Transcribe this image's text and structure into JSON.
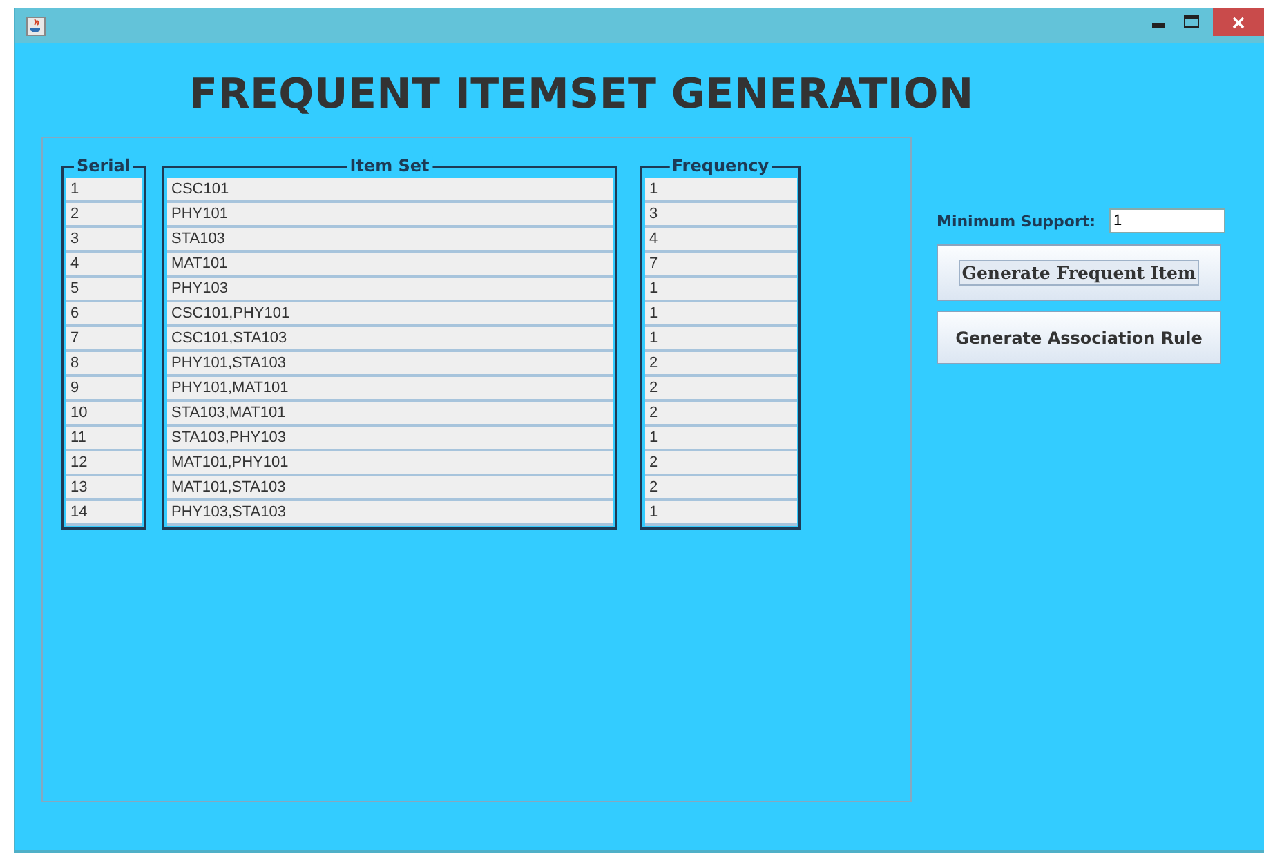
{
  "title": "FREQUENT ITEMSET GENERATION",
  "columns": [
    "Serial",
    "Item Set",
    "Frequency"
  ],
  "rows": [
    {
      "serial": "1",
      "itemset": "CSC101",
      "frequency": "1"
    },
    {
      "serial": "2",
      "itemset": "PHY101",
      "frequency": "3"
    },
    {
      "serial": "3",
      "itemset": "STA103",
      "frequency": "4"
    },
    {
      "serial": "4",
      "itemset": "MAT101",
      "frequency": "7"
    },
    {
      "serial": "5",
      "itemset": "PHY103",
      "frequency": "1"
    },
    {
      "serial": "6",
      "itemset": "CSC101,PHY101",
      "frequency": "1"
    },
    {
      "serial": "7",
      "itemset": "CSC101,STA103",
      "frequency": "1"
    },
    {
      "serial": "8",
      "itemset": "PHY101,STA103",
      "frequency": "2"
    },
    {
      "serial": "9",
      "itemset": "PHY101,MAT101",
      "frequency": "2"
    },
    {
      "serial": "10",
      "itemset": "STA103,MAT101",
      "frequency": "2"
    },
    {
      "serial": "11",
      "itemset": "STA103,PHY103",
      "frequency": "1"
    },
    {
      "serial": "12",
      "itemset": "MAT101,PHY101",
      "frequency": "2"
    },
    {
      "serial": "13",
      "itemset": "MAT101,STA103",
      "frequency": "2"
    },
    {
      "serial": "14",
      "itemset": "PHY103,STA103",
      "frequency": "1"
    }
  ],
  "minimum_support": {
    "label": "Minimum Support:",
    "value": "1"
  },
  "buttons": [
    {
      "label": "Generate Frequent Item",
      "focused": true
    },
    {
      "label": "Generate Association Rule",
      "focused": false
    }
  ]
}
